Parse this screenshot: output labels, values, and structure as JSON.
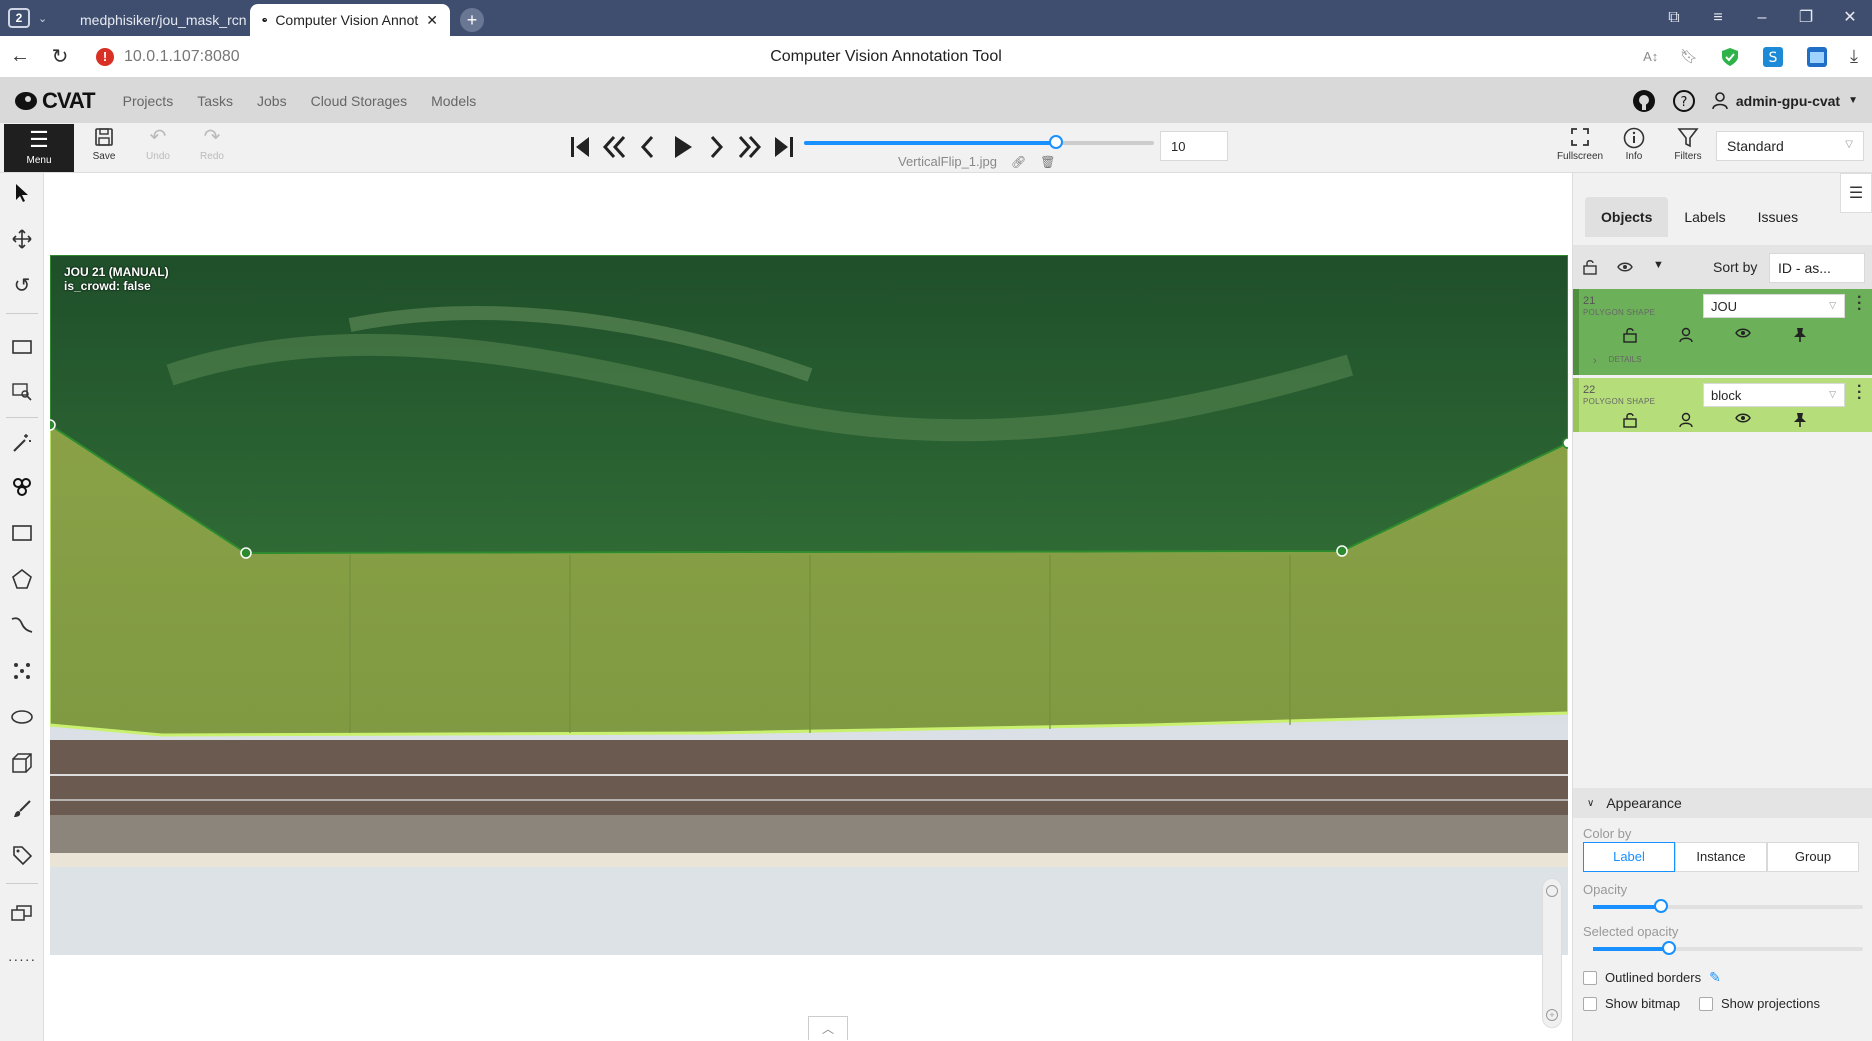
{
  "browser": {
    "tab_count": "2",
    "tabs": [
      {
        "title": "medphisiker/jou_mask_rcn"
      },
      {
        "title": "Computer Vision Annot"
      }
    ],
    "url": "10.0.1.107:8080",
    "page_title": "Computer Vision Annotation Tool"
  },
  "header": {
    "logo": "CVAT",
    "nav": [
      "Projects",
      "Tasks",
      "Jobs",
      "Cloud Storages",
      "Models"
    ],
    "user": "admin-gpu-cvat"
  },
  "toolbar": {
    "menu": "Menu",
    "save": "Save",
    "undo": "Undo",
    "redo": "Redo",
    "filename": "VerticalFlip_1.jpg",
    "frame": "10",
    "frame_progress": 0.72,
    "fullscreen": "Fullscreen",
    "info": "Info",
    "filters": "Filters",
    "workspace": "Standard"
  },
  "canvas": {
    "annotation_label_1": "JOU 21 (MANUAL)",
    "annotation_label_2": "is_crowd: false"
  },
  "sidebar": {
    "tabs": [
      "Objects",
      "Labels",
      "Issues"
    ],
    "sort_label": "Sort by",
    "sort_value": "ID - as...",
    "objects": [
      {
        "id": "21",
        "type": "POLYGON SHAPE",
        "label": "JOU",
        "details": "DETAILS",
        "color": "#6db05a"
      },
      {
        "id": "22",
        "type": "POLYGON SHAPE",
        "label": "block",
        "color": "#b5de7b"
      }
    ],
    "appearance": {
      "title": "Appearance",
      "color_by": "Color by",
      "color_options": [
        "Label",
        "Instance",
        "Group"
      ],
      "opacity": "Opacity",
      "opacity_value": 0.25,
      "selected_opacity": "Selected opacity",
      "selected_opacity_value": 0.28,
      "outlined_borders": "Outlined borders",
      "show_bitmap": "Show bitmap",
      "show_projections": "Show projections"
    }
  }
}
